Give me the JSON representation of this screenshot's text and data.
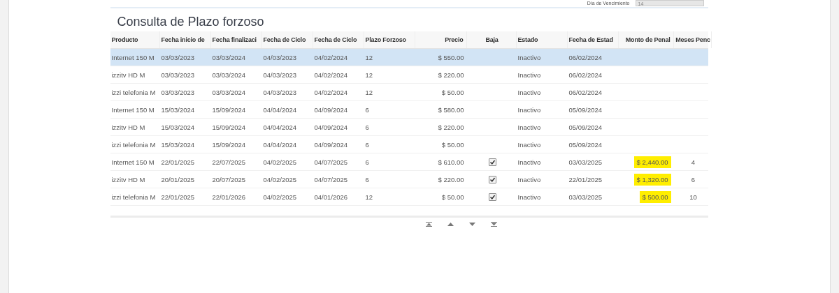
{
  "header_field": {
    "label": "Día de Vencimiento",
    "value": "14"
  },
  "title": "Consulta de Plazo forzoso",
  "table": {
    "columns": [
      "Producto",
      "Fecha inicio de",
      "Fecha finalizaci",
      "Fecha de Ciclo",
      "Fecha de Ciclo",
      "Plazo Forzoso",
      "Precio",
      "Baja",
      "Estado",
      "Fecha de Estad",
      "Monto de Penal",
      "Meses Penc"
    ],
    "rows": [
      {
        "selected": true,
        "producto": "Internet 150 M",
        "inicio": "03/03/2023",
        "fin": "03/03/2024",
        "ciclo1": "04/03/2023",
        "ciclo2": "04/02/2024",
        "plazo": "12",
        "precio": "$ 550.00",
        "baja": false,
        "estado": "Inactivo",
        "fecha_estado": "06/02/2024"
      },
      {
        "selected": false,
        "producto": "izzitv HD M",
        "inicio": "03/03/2023",
        "fin": "03/03/2024",
        "ciclo1": "04/03/2023",
        "ciclo2": "04/02/2024",
        "plazo": "12",
        "precio": "$ 220.00",
        "baja": false,
        "estado": "Inactivo",
        "fecha_estado": "06/02/2024"
      },
      {
        "selected": false,
        "producto": "izzi telefonia M",
        "inicio": "03/03/2023",
        "fin": "03/03/2024",
        "ciclo1": "04/03/2023",
        "ciclo2": "04/02/2024",
        "plazo": "12",
        "precio": "$ 50.00",
        "baja": false,
        "estado": "Inactivo",
        "fecha_estado": "06/02/2024"
      },
      {
        "selected": false,
        "producto": "Internet 150 M",
        "inicio": "15/03/2024",
        "fin": "15/09/2024",
        "ciclo1": "04/04/2024",
        "ciclo2": "04/09/2024",
        "plazo": "6",
        "precio": "$ 580.00",
        "baja": false,
        "estado": "Inactivo",
        "fecha_estado": "05/09/2024"
      },
      {
        "selected": false,
        "producto": "izzitv HD M",
        "inicio": "15/03/2024",
        "fin": "15/09/2024",
        "ciclo1": "04/04/2024",
        "ciclo2": "04/09/2024",
        "plazo": "6",
        "precio": "$ 220.00",
        "baja": false,
        "estado": "Inactivo",
        "fecha_estado": "05/09/2024"
      },
      {
        "selected": false,
        "producto": "izzi telefonia M",
        "inicio": "15/03/2024",
        "fin": "15/09/2024",
        "ciclo1": "04/04/2024",
        "ciclo2": "04/09/2024",
        "plazo": "6",
        "precio": "$ 50.00",
        "baja": false,
        "estado": "Inactivo",
        "fecha_estado": "05/09/2024"
      },
      {
        "selected": false,
        "producto": "Internet 150 M",
        "inicio": "22/01/2025",
        "fin": "22/07/2025",
        "ciclo1": "04/02/2025",
        "ciclo2": "04/07/2025",
        "plazo": "6",
        "precio": "$ 610.00",
        "baja": true,
        "estado": "Inactivo",
        "fecha_estado": "03/03/2025",
        "monto": "$ 2,440.00",
        "monto_highlighted": true,
        "meses": "4"
      },
      {
        "selected": false,
        "producto": "izzitv HD M",
        "inicio": "20/01/2025",
        "fin": "20/07/2025",
        "ciclo1": "04/02/2025",
        "ciclo2": "04/07/2025",
        "plazo": "6",
        "precio": "$ 220.00",
        "baja": true,
        "estado": "Inactivo",
        "fecha_estado": "22/01/2025",
        "monto": "$ 1,320.00",
        "monto_highlighted": true,
        "meses": "6"
      },
      {
        "selected": false,
        "producto": "izzi telefonia M",
        "inicio": "22/01/2025",
        "fin": "22/01/2026",
        "ciclo1": "04/02/2025",
        "ciclo2": "04/01/2026",
        "plazo": "12",
        "precio": "$ 50.00",
        "baja": true,
        "estado": "Inactivo",
        "fecha_estado": "03/03/2025",
        "monto": "$ 500.00",
        "monto_highlighted": true,
        "meses": "10"
      }
    ]
  }
}
